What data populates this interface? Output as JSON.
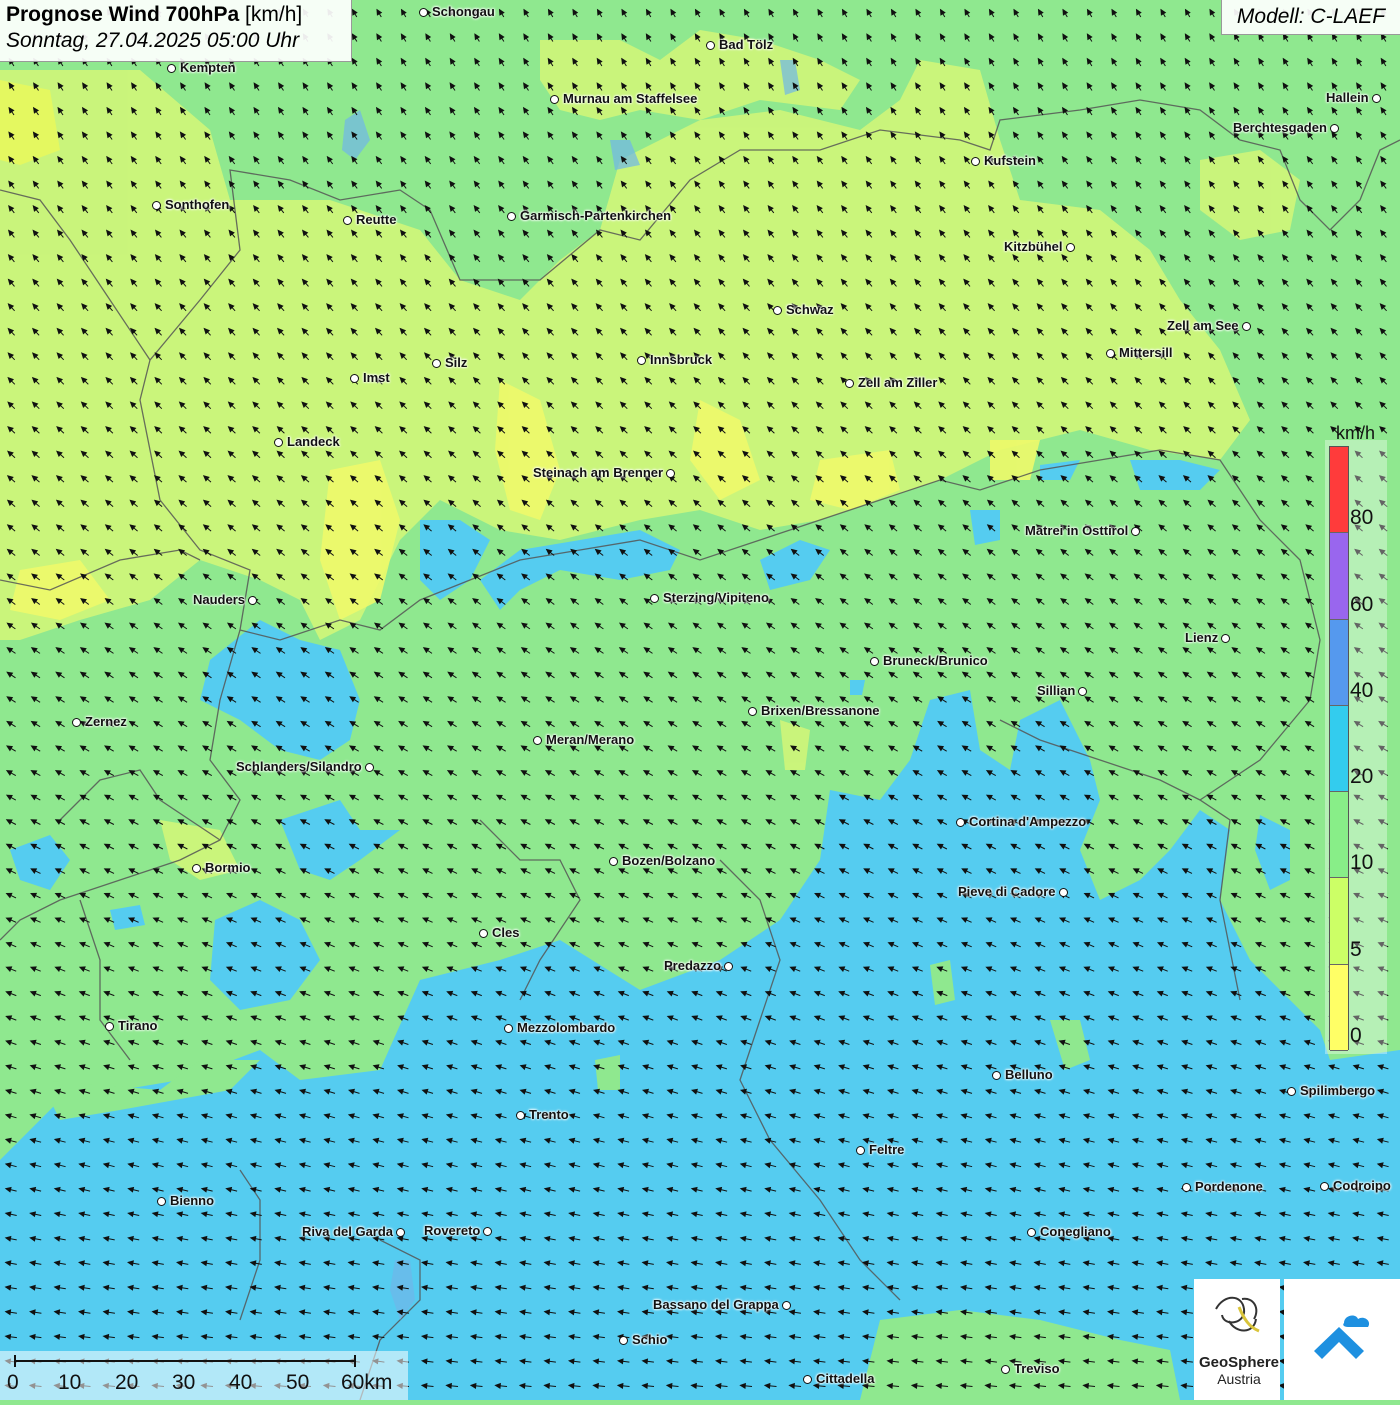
{
  "header": {
    "title_main": "Prognose Wind 700hPa",
    "title_unit": "[km/h]",
    "datetime": "Sonntag, 27.04.2025 05:00 Uhr",
    "model": "Modell: C-LAEF"
  },
  "legend": {
    "unit": "km/h",
    "labels": [
      "80",
      "60",
      "40",
      "20",
      "10",
      "5",
      "0"
    ],
    "colors": [
      "#ff3b3b",
      "#9966ee",
      "#5599ee",
      "#33ccee",
      "#88ee88",
      "#ccff66",
      "#ffff66"
    ]
  },
  "scale_bar": {
    "labels": [
      "0",
      "10",
      "20",
      "30",
      "40",
      "50",
      "60km"
    ]
  },
  "logo": {
    "org_line1": "GeoSphere",
    "org_line2": "Austria"
  },
  "colors": {
    "green": "#8fe88f",
    "yellow_green": "#ccf577",
    "cyan": "#55ccf0"
  },
  "cities": [
    {
      "name": "Schongau",
      "side": "right"
    },
    {
      "name": "Bad Tölz",
      "side": "right"
    },
    {
      "name": "Kempten",
      "side": "right"
    },
    {
      "name": "Murnau am Staffelsee",
      "side": "right"
    },
    {
      "name": "Hallein",
      "side": "left"
    },
    {
      "name": "Berchtesgaden",
      "side": "left"
    },
    {
      "name": "Kufstein",
      "side": "right"
    },
    {
      "name": "Sonthofen",
      "side": "right"
    },
    {
      "name": "Reutte",
      "side": "right"
    },
    {
      "name": "Garmisch-Partenkirchen",
      "side": "right"
    },
    {
      "name": "Kitzbühel",
      "side": "left"
    },
    {
      "name": "Schwaz",
      "side": "right"
    },
    {
      "name": "Zell am See",
      "side": "left"
    },
    {
      "name": "Mittersill",
      "side": "right"
    },
    {
      "name": "Silz",
      "side": "right"
    },
    {
      "name": "Innsbruck",
      "side": "right"
    },
    {
      "name": "Imst",
      "side": "right"
    },
    {
      "name": "Zell am Ziller",
      "side": "right"
    },
    {
      "name": "Landeck",
      "side": "right"
    },
    {
      "name": "Steinach am Brenner",
      "side": "left"
    },
    {
      "name": "Matrei in Osttirol",
      "side": "left"
    },
    {
      "name": "Nauders",
      "side": "left"
    },
    {
      "name": "Sterzing/Vipiteno",
      "side": "right"
    },
    {
      "name": "Lienz",
      "side": "left"
    },
    {
      "name": "Bruneck/Brunico",
      "side": "right"
    },
    {
      "name": "Sillian",
      "side": "left"
    },
    {
      "name": "Zernez",
      "side": "right"
    },
    {
      "name": "Brixen/Bressanone",
      "side": "right"
    },
    {
      "name": "Meran/Merano",
      "side": "right"
    },
    {
      "name": "Schlanders/Silandro",
      "side": "left"
    },
    {
      "name": "Cortina d'Ampezzo",
      "side": "right"
    },
    {
      "name": "Bozen/Bolzano",
      "side": "right"
    },
    {
      "name": "Bormio",
      "side": "right"
    },
    {
      "name": "Pieve di Cadore",
      "side": "left"
    },
    {
      "name": "Cles",
      "side": "right"
    },
    {
      "name": "Predazzo",
      "side": "left"
    },
    {
      "name": "Tirano",
      "side": "right"
    },
    {
      "name": "Mezzolombardo",
      "side": "right"
    },
    {
      "name": "Belluno",
      "side": "right"
    },
    {
      "name": "Spilimbergo",
      "side": "right"
    },
    {
      "name": "Trento",
      "side": "right"
    },
    {
      "name": "Feltre",
      "side": "right"
    },
    {
      "name": "Pordenone",
      "side": "right"
    },
    {
      "name": "Codroipo",
      "side": "right"
    },
    {
      "name": "Bienno",
      "side": "right"
    },
    {
      "name": "Riva del Garda",
      "side": "left"
    },
    {
      "name": "Rovereto",
      "side": "left"
    },
    {
      "name": "Conegliano",
      "side": "right"
    },
    {
      "name": "Bassano del Grappa",
      "side": "left"
    },
    {
      "name": "Schio",
      "side": "right"
    },
    {
      "name": "Treviso",
      "side": "right"
    },
    {
      "name": "Cittadella",
      "side": "right"
    }
  ]
}
